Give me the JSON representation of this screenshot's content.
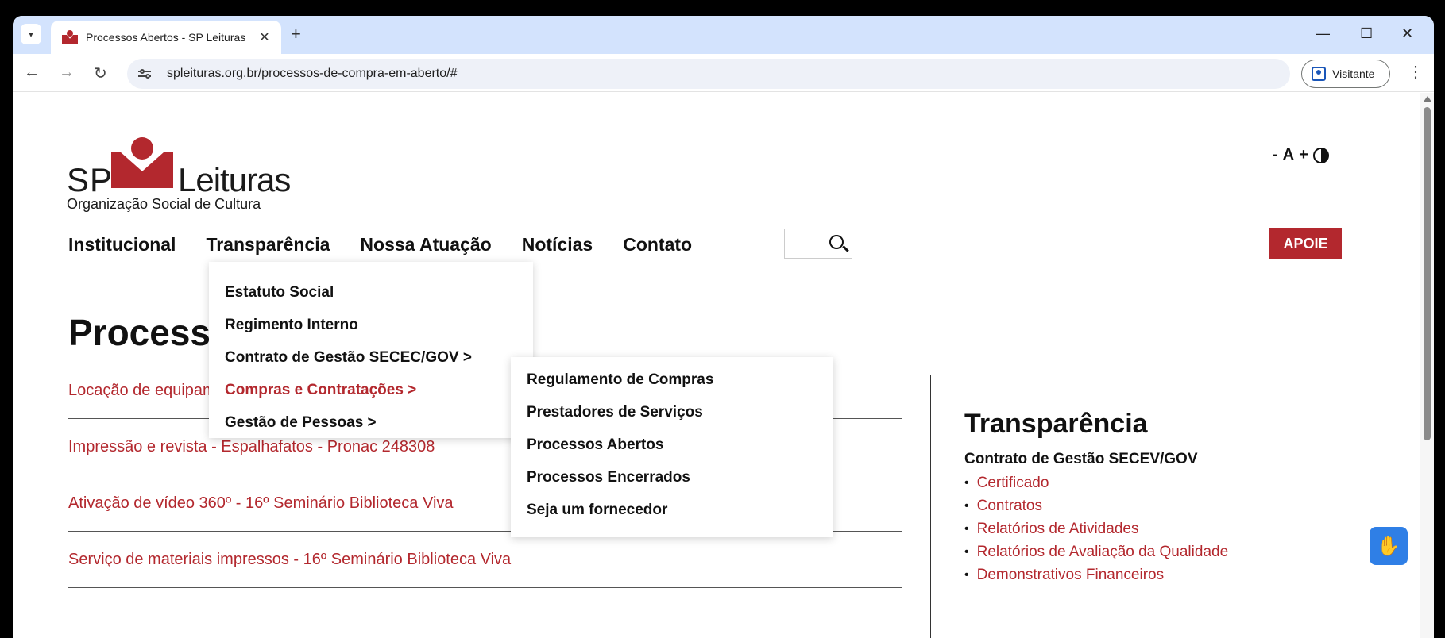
{
  "browser": {
    "tab_title": "Processos Abertos - SP Leituras",
    "tab_close": "✕",
    "new_tab": "+",
    "url": "spleituras.org.br/processos-de-compra-em-aberto/#",
    "profile_label": "Visitante",
    "controls": {
      "minimize": "—",
      "maximize": "☐",
      "close": "✕"
    },
    "nav": {
      "back": "←",
      "forward": "→",
      "reload": "↻",
      "menu": "⋮",
      "tab_search": "▾"
    }
  },
  "site": {
    "logo": {
      "sp": "SP",
      "leituras": "Leituras",
      "tagline": "Organização Social de Cultura"
    },
    "accessibility": {
      "decrease": "-",
      "font": "A",
      "increase": "+"
    },
    "nav": [
      "Institucional",
      "Transparência",
      "Nossa Atuação",
      "Notícias",
      "Contato"
    ],
    "apoie": "APOIE",
    "page_title": "Processos Abertos",
    "processes": [
      "Locação de equipamentos",
      "Impressão e revista - Espalhafatos - Pronac 248308",
      "Ativação de vídeo 360º - 16º Seminário Biblioteca Viva",
      "Serviço de materiais impressos - 16º Seminário Biblioteca Viva"
    ],
    "dropdown": [
      "Estatuto Social",
      "Regimento Interno",
      "Contrato de Gestão SECEC/GOV >",
      "Compras e Contratações >",
      "Gestão de Pessoas >"
    ],
    "submenu": [
      "Regulamento de Compras",
      "Prestadores de Serviços",
      "Processos Abertos",
      "Processos Encerrados",
      "Seja um fornecedor"
    ],
    "transparency_panel": {
      "title": "Transparência",
      "subtitle": "Contrato de Gestão SECEV/GOV",
      "links": [
        "Certificado",
        "Contratos",
        "Relatórios de Atividades",
        "Relatórios de Avaliação da Qualidade",
        "Demonstrativos Financeiros"
      ]
    },
    "colors": {
      "brand": "#b3282e",
      "vlibras": "#2f7fe6"
    }
  }
}
